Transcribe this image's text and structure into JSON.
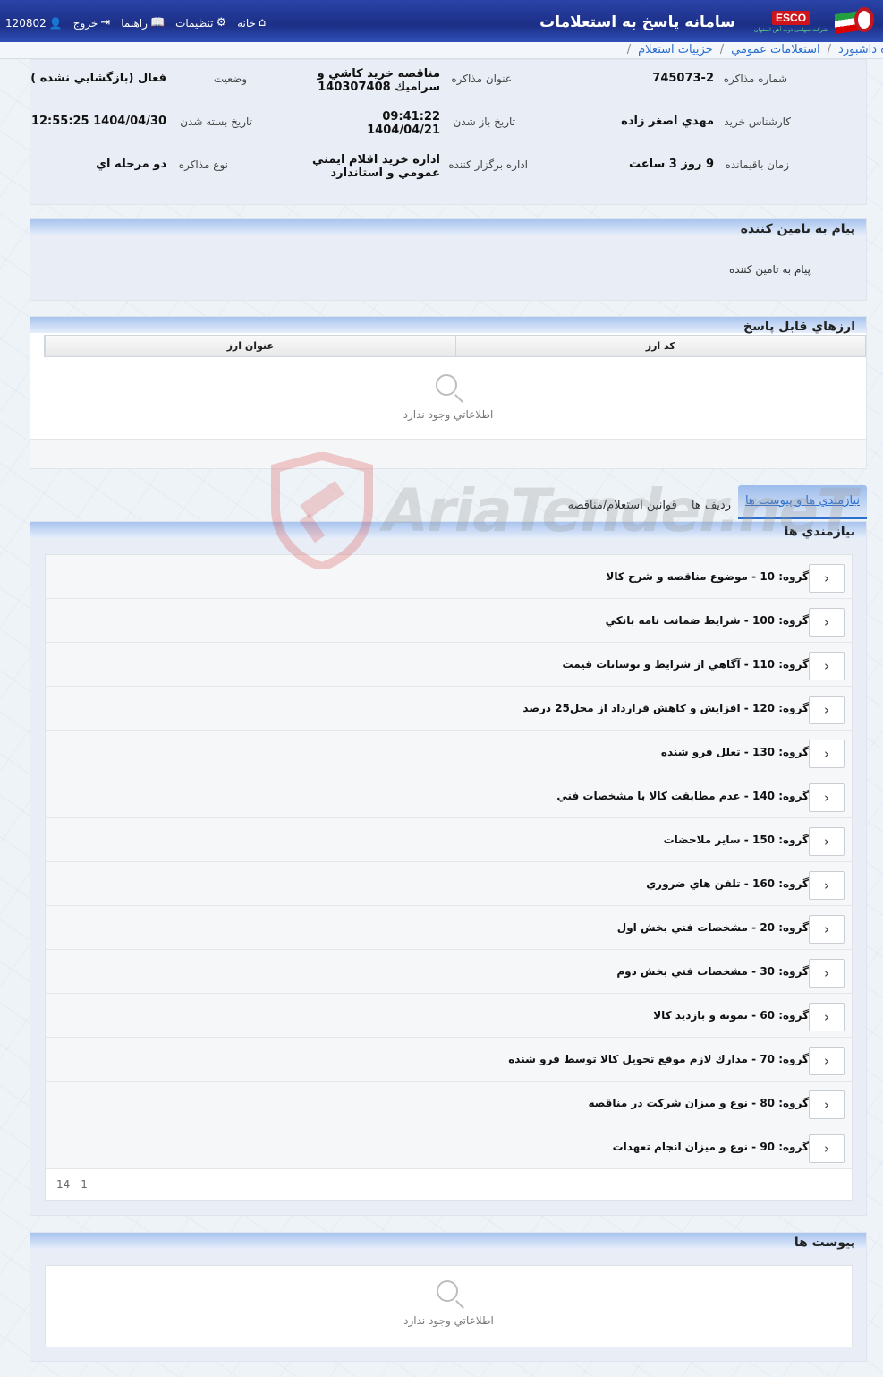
{
  "header": {
    "app_title": "سامانه پاسخ به استعلامات",
    "esco": "ESCO",
    "esco_sub": "شرکت سهامی ذوب آهن اصفهان",
    "nav": {
      "home": "خانه",
      "settings": "تنظیمات",
      "help": "راهنما",
      "logout": "خروج",
      "user_id": "120802"
    }
  },
  "breadcrumb": {
    "items": [
      "ه داشبورد",
      "استعلامات عمومي",
      "جزييات استعلام"
    ]
  },
  "info": {
    "number_label": "شماره مذاکره",
    "number_value": "745073-2",
    "title_label": "عنوان مذاكره",
    "title_value_1": "مناقصه خريد كاشي و",
    "title_value_2": "سراميك 140307408",
    "status_label": "وضعيت",
    "status_value": "فعال (بازگشايي نشده )",
    "expert_label": "کارشناس خرید",
    "expert_value": "مهدي اصغر زاده",
    "open_label": "تاريخ باز شدن",
    "open_time": "09:41:22",
    "open_date": "1404/04/21",
    "close_label": "تاريخ بسته شدن",
    "close_value": "1404/04/30 12:55:25",
    "remaining_label": "زمان باقيمانده",
    "remaining_value": "9 روز 3 ساعت",
    "dept_label": "اداره برگزار کننده",
    "dept_value_1": "اداره خريد اقلام ايمني",
    "dept_value_2": "عمومي و استاندارد",
    "type_label": "نوع مذاکره",
    "type_value": "دو مرحله اي"
  },
  "message": {
    "title": "پیام به تامین کننده",
    "text": "پیام به تامین کننده"
  },
  "currencies": {
    "title": "ارزهاي قابل پاسخ",
    "col_code": "کد ارز",
    "col_title": "عنوان ارز",
    "empty": "اطلاعاتي وجود ندارد"
  },
  "tabs": {
    "active": "نيازمندي ها و پيوست ها",
    "rows": "رديف ها",
    "rules": "قوانين استعلام/مناقصه"
  },
  "requirements": {
    "title": "نيازمندي ها",
    "items": [
      "گروه: 10 - موضوع مناقصه و شرح كالا",
      "گروه: 100 - شرايط ضمانت نامه بانكي",
      "گروه: 110 - آگاهي از شرايط و نوسانات قيمت",
      "گروه: 120 - افزايش و كاهش قرارداد از محل25 درصد",
      "گروه: 130 - تعلل فرو شنده",
      "گروه: 140 - عدم مطابقت كالا با مشخصات فني",
      "گروه: 150 - ساير ملاحضات",
      "گروه: 160 - تلفن هاي ضروري",
      "گروه: 20 - مشخصات فني بخش اول",
      "گروه: 30 - مشخصات فني بخش دوم",
      "گروه: 60 - نمونه و بازديد كالا",
      "گروه: 70 - مدارك لازم موقع تحويل كالا توسط فرو شنده",
      "گروه: 80 - نوع و ميزان شركت در مناقصه",
      "گروه: 90 - نوع و ميزان انجام تعهدات"
    ],
    "pager": "1 - 14"
  },
  "attachments": {
    "title": "پیوست ها",
    "empty": "اطلاعاتي وجود ندارد"
  },
  "watermark": "AriaTender.neT"
}
